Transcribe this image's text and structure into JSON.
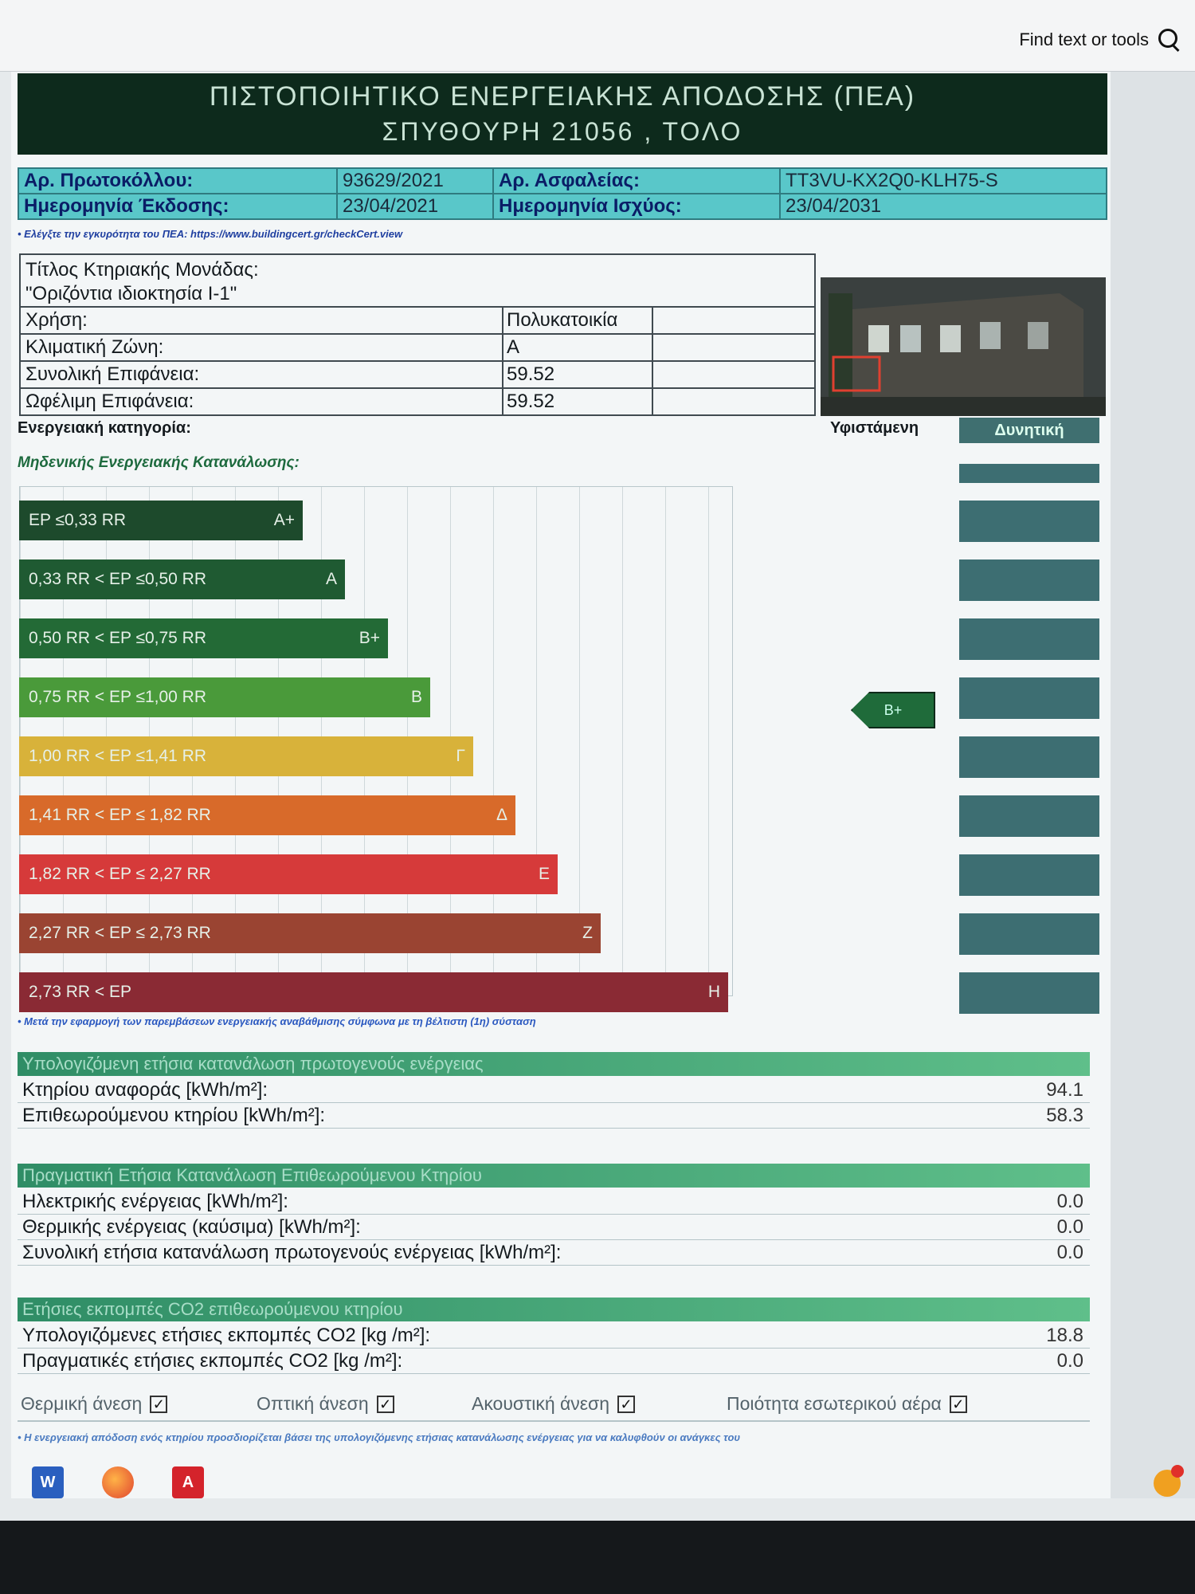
{
  "viewer": {
    "find_label": "Find text or tools"
  },
  "certificate": {
    "title_line1": "ΠΙΣΤΟΠΟΙΗΤΙΚΟ ΕΝΕΡΓΕΙΑΚΗΣ ΑΠΟΔΟΣΗΣ (ΠΕΑ)",
    "title_line2": "ΣΠΥΘΟΥΡΗ 21056 , ΤΟΛΟ",
    "protocol_label": "Αρ. Πρωτοκόλλου:",
    "protocol_value": "93629/2021",
    "insurance_label": "Αρ. Ασφαλείας:",
    "insurance_value": "TT3VU-KX2Q0-KLH75-S",
    "issue_label": "Ημερομηνία Έκδοσης:",
    "issue_value": "23/04/2021",
    "validity_label": "Ημερομηνία Ισχύος:",
    "validity_value": "23/04/2031",
    "verify_note": "• Ελέγξτε την εγκυρότητα του ΠΕΑ: https://www.buildingcert.gr/checkCert.view"
  },
  "unit": {
    "title_label": "Τίτλος Κτηριακής Μονάδας:",
    "title_value": "\"Οριζόντια ιδιοκτησία Ι-1\"",
    "use_label": "Χρήση:",
    "use_value": "Πολυκατοικία",
    "zone_label": "Κλιματική Ζώνη:",
    "zone_value": "Α",
    "total_area_label": "Συνολική Επιφάνεια:",
    "total_area_value": "59.52",
    "useful_area_label": "Ωφέλιμη Επιφάνεια:",
    "useful_area_value": "59.52"
  },
  "energy": {
    "category_label": "Ενεργειακή κατηγορία:",
    "existing_label": "Υφιστάμενη",
    "potential_label": "Δυνητική",
    "zero_label": "Μηδενικής Ενεργειακής Κατανάλωσης:",
    "existing_class": "B+",
    "bands": [
      {
        "range": "EP ≤0,33 RR",
        "cls": "A+",
        "color": "#1d4a2c",
        "fill": 0.4
      },
      {
        "range": "0,33 RR < EP ≤0,50 RR",
        "cls": "A",
        "color": "#1f5a32",
        "fill": 0.46
      },
      {
        "range": "0,50 RR < EP ≤0,75 RR",
        "cls": "B+",
        "color": "#236a36",
        "fill": 0.52
      },
      {
        "range": "0,75 RR < EP ≤1,00 RR",
        "cls": "B",
        "color": "#4a9a3a",
        "fill": 0.58
      },
      {
        "range": "1,00 RR < EP ≤1,41 RR",
        "cls": "Γ",
        "color": "#d8b23a",
        "fill": 0.64
      },
      {
        "range": "1,41 RR < EP ≤ 1,82 RR",
        "cls": "Δ",
        "color": "#d86a2a",
        "fill": 0.7
      },
      {
        "range": "1,82 RR < EP ≤ 2,27 RR",
        "cls": "Ε",
        "color": "#d63a3a",
        "fill": 0.76
      },
      {
        "range": "2,27 RR < EP ≤ 2,73 RR",
        "cls": "Ζ",
        "color": "#9a4432",
        "fill": 0.82
      },
      {
        "range": "2,73 RR < EP",
        "cls": "Η",
        "color": "#8a2a34",
        "fill": 1.0
      }
    ],
    "footnote": "• Μετά την εφαρμογή των παρεμβάσεων ενεργειακής αναβάθμισης σύμφωνα με τη βέλτιστη (1η) σύσταση"
  },
  "primary": {
    "header": "Υπολογιζόμενη ετήσια κατανάλωση πρωτογενούς ενέργειας",
    "ref_label": "Κτηρίου αναφοράς [kWh/m²]:",
    "ref_value": "94.1",
    "insp_label": "Επιθεωρούμενου κτηρίου [kWh/m²]:",
    "insp_value": "58.3"
  },
  "actual": {
    "header": "Πραγματική Ετήσια Κατανάλωση Επιθεωρούμενου Κτηρίου",
    "elec_label": "Ηλεκτρικής ενέργειας [kWh/m²]:",
    "elec_value": "0.0",
    "thermal_label": "Θερμικής ενέργειας (καύσιμα) [kWh/m²]:",
    "thermal_value": "0.0",
    "total_label": "Συνολική ετήσια κατανάλωση πρωτογενούς ενέργειας [kWh/m²]:",
    "total_value": "0.0"
  },
  "co2": {
    "header": "Ετήσιες εκπομπές CO2 επιθεωρούμενου κτηρίου",
    "calc_label": "Υπολογιζόμενες ετήσιες εκπομπές CO2 [kg /m²]:",
    "calc_value": "18.8",
    "actual_label": "Πραγματικές ετήσιες εκπομπές CO2 [kg /m²]:",
    "actual_value": "0.0"
  },
  "comfort": {
    "thermal": "Θερμική άνεση",
    "optical": "Οπτική άνεση",
    "acoustic": "Ακουστική άνεση",
    "air": "Ποιότητα εσωτερικού αέρα",
    "check": "✓",
    "note": "• Η ενεργειακή απόδοση ενός κτηρίου προσδιορίζεται βάσει της υπολογιζόμενης ετήσιας κατανάλωσης ενέργειας για να καλυφθούν οι ανάγκες του"
  },
  "taskbar": {
    "word": "W",
    "pdf": "A"
  }
}
